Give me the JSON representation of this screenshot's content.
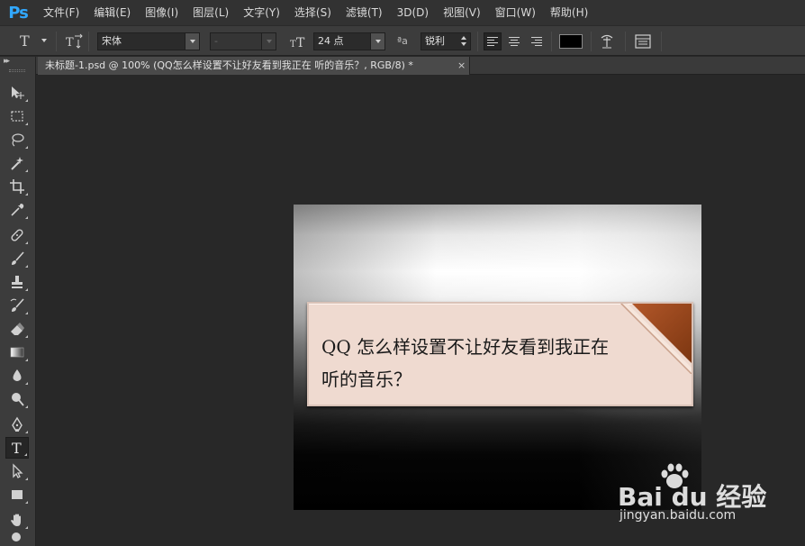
{
  "app": {
    "logo": "Ps"
  },
  "menu": [
    "文件(F)",
    "编辑(E)",
    "图像(I)",
    "图层(L)",
    "文字(Y)",
    "选择(S)",
    "滤镜(T)",
    "3D(D)",
    "视图(V)",
    "窗口(W)",
    "帮助(H)"
  ],
  "options": {
    "tool_glyph": "T",
    "font_family": "宋体",
    "font_style": "-",
    "font_size": "24 点",
    "aa_glyph": "ªa",
    "antialias": "锐利",
    "text_color": "#000000"
  },
  "document": {
    "tab_title": "未标题-1.psd @ 100% (QQ怎么样设置不让好友看到我正在 听的音乐？, RGB/8) *",
    "tab_close": "×"
  },
  "canvas": {
    "banner_line1": "QQ 怎么样设置不让好友看到我正在",
    "banner_line2": "听的音乐？",
    "banner_color": "#efdad0",
    "accent_color": "#9a4a1f"
  },
  "tools": [
    "move",
    "marquee",
    "lasso",
    "magic-wand",
    "crop",
    "eyedropper",
    "healing-brush",
    "brush",
    "clone-stamp",
    "history-brush",
    "eraser",
    "gradient",
    "blur",
    "dodge",
    "pen",
    "type",
    "path-selection",
    "rectangle",
    "hand",
    "zoom"
  ],
  "active_tool": "type",
  "watermark": {
    "logo_text": "Bai du 经验",
    "url": "jingyan.baidu.com"
  }
}
